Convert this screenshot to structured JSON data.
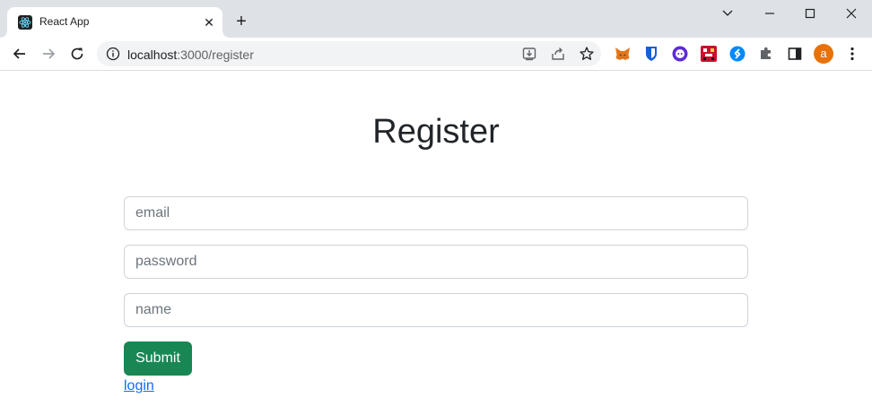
{
  "browser": {
    "tab": {
      "title": "React App",
      "close_glyph": "✕"
    },
    "new_tab_glyph": "+",
    "url": {
      "host": "localhost",
      "path": ":3000/register"
    },
    "profile_initial": "a"
  },
  "page": {
    "title": "Register",
    "fields": [
      {
        "placeholder": "email",
        "value": ""
      },
      {
        "placeholder": "password",
        "value": ""
      },
      {
        "placeholder": "name",
        "value": ""
      }
    ],
    "submit_label": "Submit",
    "login_link": "login"
  },
  "colors": {
    "submit": "#198754",
    "link": "#0d6efd",
    "avatar": "#e8710a"
  }
}
